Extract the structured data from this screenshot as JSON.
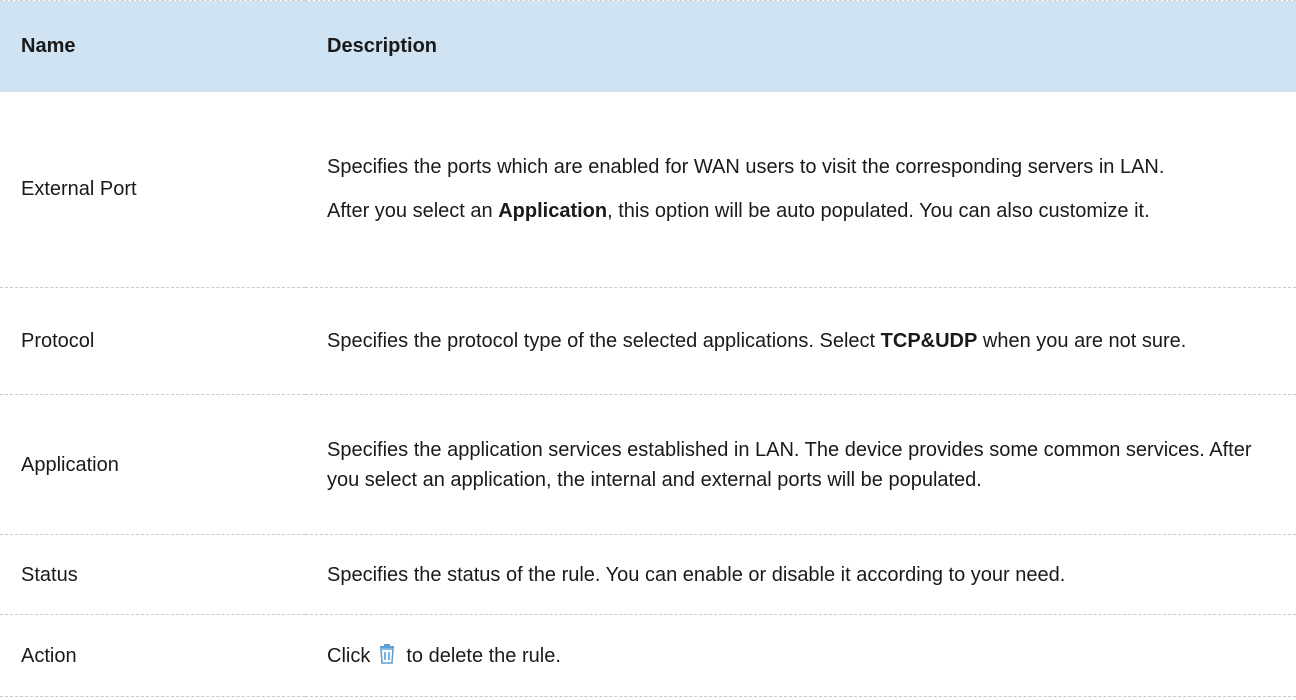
{
  "table": {
    "headers": {
      "name": "Name",
      "description": "Description"
    },
    "rows": {
      "external_port": {
        "name": "External Port",
        "desc1": "Specifies the ports which are enabled for WAN users to visit the corresponding servers in LAN.",
        "desc2_pre": "After you select an ",
        "desc2_bold": "Application",
        "desc2_post": ", this option will be auto populated. You can also customize it."
      },
      "protocol": {
        "name": "Protocol",
        "desc_pre": "Specifies the protocol type of the selected applications. Select ",
        "desc_bold": "TCP&UDP",
        "desc_post": " when you are not sure."
      },
      "application": {
        "name": "Application",
        "desc": "Specifies the application services established in LAN. The device provides some common services. After you select an application, the internal and external ports will be populated."
      },
      "status": {
        "name": "Status",
        "desc": "Specifies the status of the rule. You can enable or disable it according to your need."
      },
      "action": {
        "name": "Action",
        "desc_pre": "Click",
        "icon": "trash-icon",
        "desc_post": "to delete the rule."
      }
    }
  },
  "colors": {
    "header_bg": "#cfe3f2",
    "trash_icon": "#5aa0d8"
  }
}
